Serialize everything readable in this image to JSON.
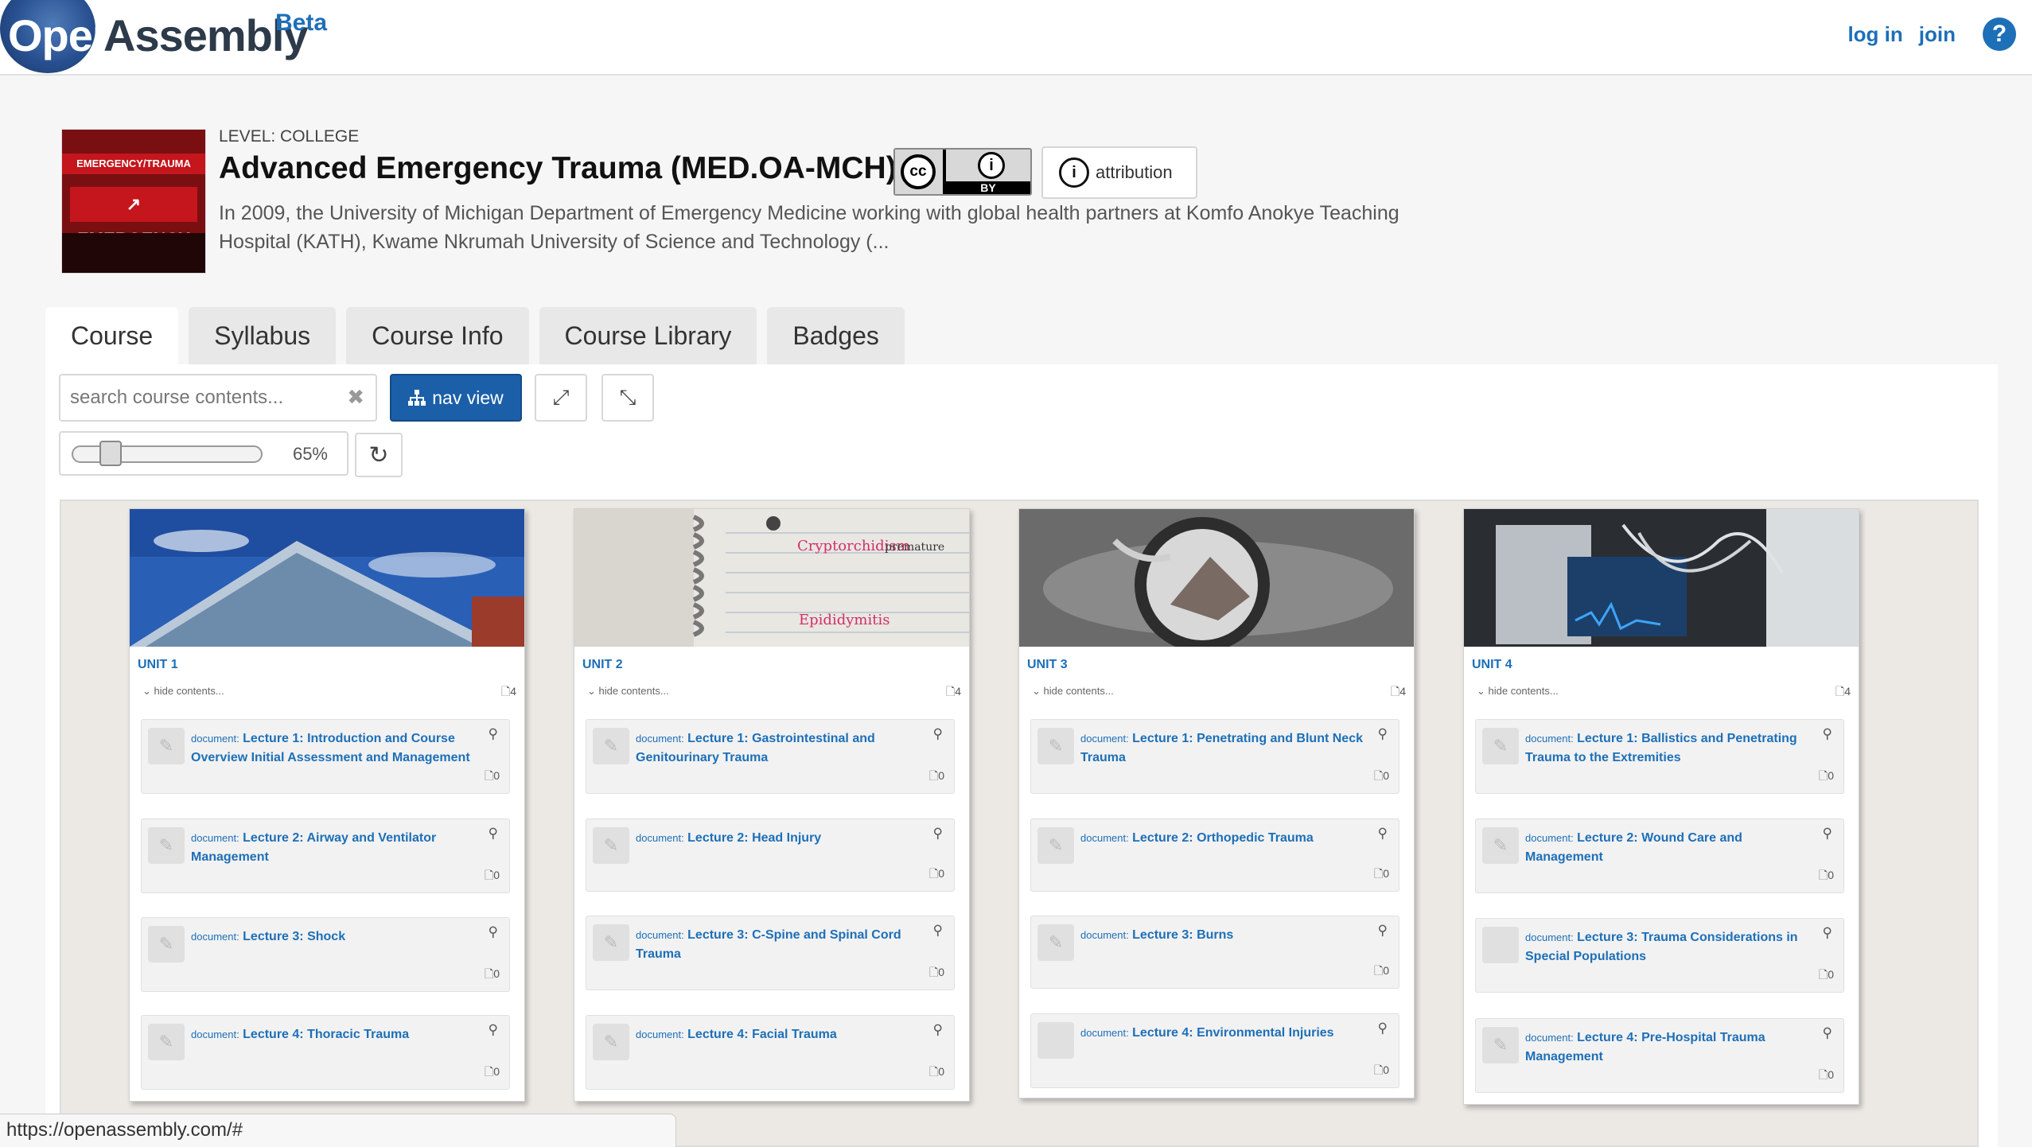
{
  "header": {
    "logo_open": "Open",
    "logo_assembly": "Assembly",
    "logo_beta": "Beta",
    "login": "log in",
    "join": "join",
    "help": "?"
  },
  "course": {
    "thumb_band_top": "EMERGENCY/TRAUMA",
    "thumb_band_main": "↗ EMERGENCY",
    "level": "LEVEL: COLLEGE",
    "title": "Advanced Emergency Trauma (MED.OA-MCH)",
    "license_cc": "cc",
    "license_by": "BY",
    "attribution_label": "attribution",
    "description": "In 2009, the University of Michigan Department of Emergency Medicine working with global health partners at Komfo Anokye Teaching Hospital (KATH), Kwame Nkrumah University of Science and Technology (..."
  },
  "tabs": [
    {
      "label": "Course",
      "active": true
    },
    {
      "label": "Syllabus"
    },
    {
      "label": "Course Info"
    },
    {
      "label": "Course Library"
    },
    {
      "label": "Badges"
    }
  ],
  "toolbar": {
    "search_placeholder": "search course contents...",
    "nav_view_label": "nav view",
    "zoom_value": "65%",
    "zoom_fraction": 0.65
  },
  "units": [
    {
      "title": "UNIT 1",
      "hide_label": "hide contents...",
      "doc_count": "4",
      "lectures": [
        {
          "type": "document:",
          "title": "Lecture 1: Introduction and Course Overview Initial Assessment and Management",
          "count": "0"
        },
        {
          "type": "document:",
          "title": "Lecture 2: Airway and Ventilator Management",
          "count": "0"
        },
        {
          "type": "document:",
          "title": "Lecture 3: Shock",
          "count": "0"
        },
        {
          "type": "document:",
          "title": "Lecture 4: Thoracic Trauma",
          "count": "0"
        }
      ]
    },
    {
      "title": "UNIT 2",
      "hide_label": "hide contents...",
      "doc_count": "4",
      "lectures": [
        {
          "type": "document:",
          "title": "Lecture 1: Gastrointestinal and Genitourinary Trauma",
          "count": "0"
        },
        {
          "type": "document:",
          "title": "Lecture 2: Head Injury",
          "count": "0"
        },
        {
          "type": "document:",
          "title": "Lecture 3: C-Spine and Spinal Cord Trauma",
          "count": "0"
        },
        {
          "type": "document:",
          "title": "Lecture 4: Facial Trauma",
          "count": "0"
        }
      ]
    },
    {
      "title": "UNIT 3",
      "hide_label": "hide contents...",
      "doc_count": "4",
      "lectures": [
        {
          "type": "document:",
          "title": "Lecture 1: Penetrating and Blunt Neck Trauma",
          "count": "0"
        },
        {
          "type": "document:",
          "title": "Lecture 2: Orthopedic Trauma",
          "count": "0"
        },
        {
          "type": "document:",
          "title": "Lecture 3: Burns",
          "count": "0"
        },
        {
          "type": "document:",
          "title": "Lecture 4: Environmental Injuries",
          "count": "0"
        }
      ]
    },
    {
      "title": "UNIT 4",
      "hide_label": "hide contents...",
      "doc_count": "4",
      "lectures": [
        {
          "type": "document:",
          "title": "Lecture 1: Ballistics and Penetrating Trauma to the Extremities",
          "count": "0"
        },
        {
          "type": "document:",
          "title": "Lecture 2: Wound Care and Management",
          "count": "0"
        },
        {
          "type": "document:",
          "title": "Lecture 3: Trauma Considerations in Special Populations",
          "count": "0"
        },
        {
          "type": "document:",
          "title": "Lecture 4: Pre-Hospital Trauma Management",
          "count": "0"
        }
      ]
    }
  ],
  "status_url": "https://openassembly.com/#",
  "colors": {
    "link_blue": "#1d6fb8",
    "nav_button": "#1b5fa8",
    "workspace_bg": "#ece9e5"
  }
}
